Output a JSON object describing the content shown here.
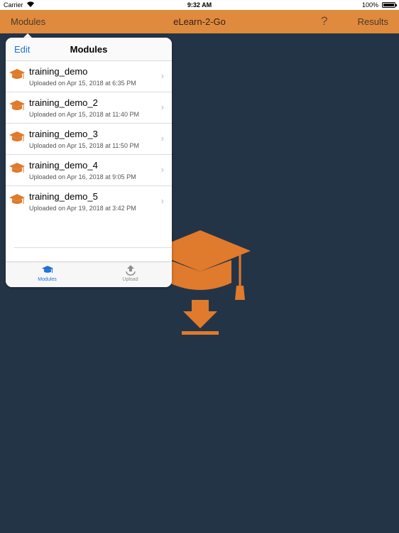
{
  "status_bar": {
    "carrier": "Carrier",
    "time": "9:32 AM",
    "battery": "100%"
  },
  "nav_bar": {
    "left": "Modules",
    "title": "eLearn-2-Go",
    "help": "?",
    "right": "Results",
    "color": "#e08a3e"
  },
  "popover": {
    "edit": "Edit",
    "title": "Modules",
    "modules": [
      {
        "name": "training_demo",
        "uploaded": "Uploaded on Apr 15, 2018 at 6:35 PM"
      },
      {
        "name": "training_demo_2",
        "uploaded": "Uploaded on Apr 15, 2018 at 11:40 PM"
      },
      {
        "name": "training_demo_3",
        "uploaded": "Uploaded on Apr 15, 2018 at 11:50 PM"
      },
      {
        "name": "training_demo_4",
        "uploaded": "Uploaded on Apr 16, 2018 at 9:05 PM"
      },
      {
        "name": "training_demo_5",
        "uploaded": "Uploaded on Apr 19, 2018 at 3:42 PM"
      }
    ],
    "tabs": [
      {
        "label": "Modules",
        "icon": "graduation-cap-icon",
        "active": true
      },
      {
        "label": "Upload",
        "icon": "upload-icon",
        "active": false
      }
    ]
  },
  "colors": {
    "background": "#243447",
    "accent": "#e08a3e",
    "tint": "#1e72d8"
  }
}
